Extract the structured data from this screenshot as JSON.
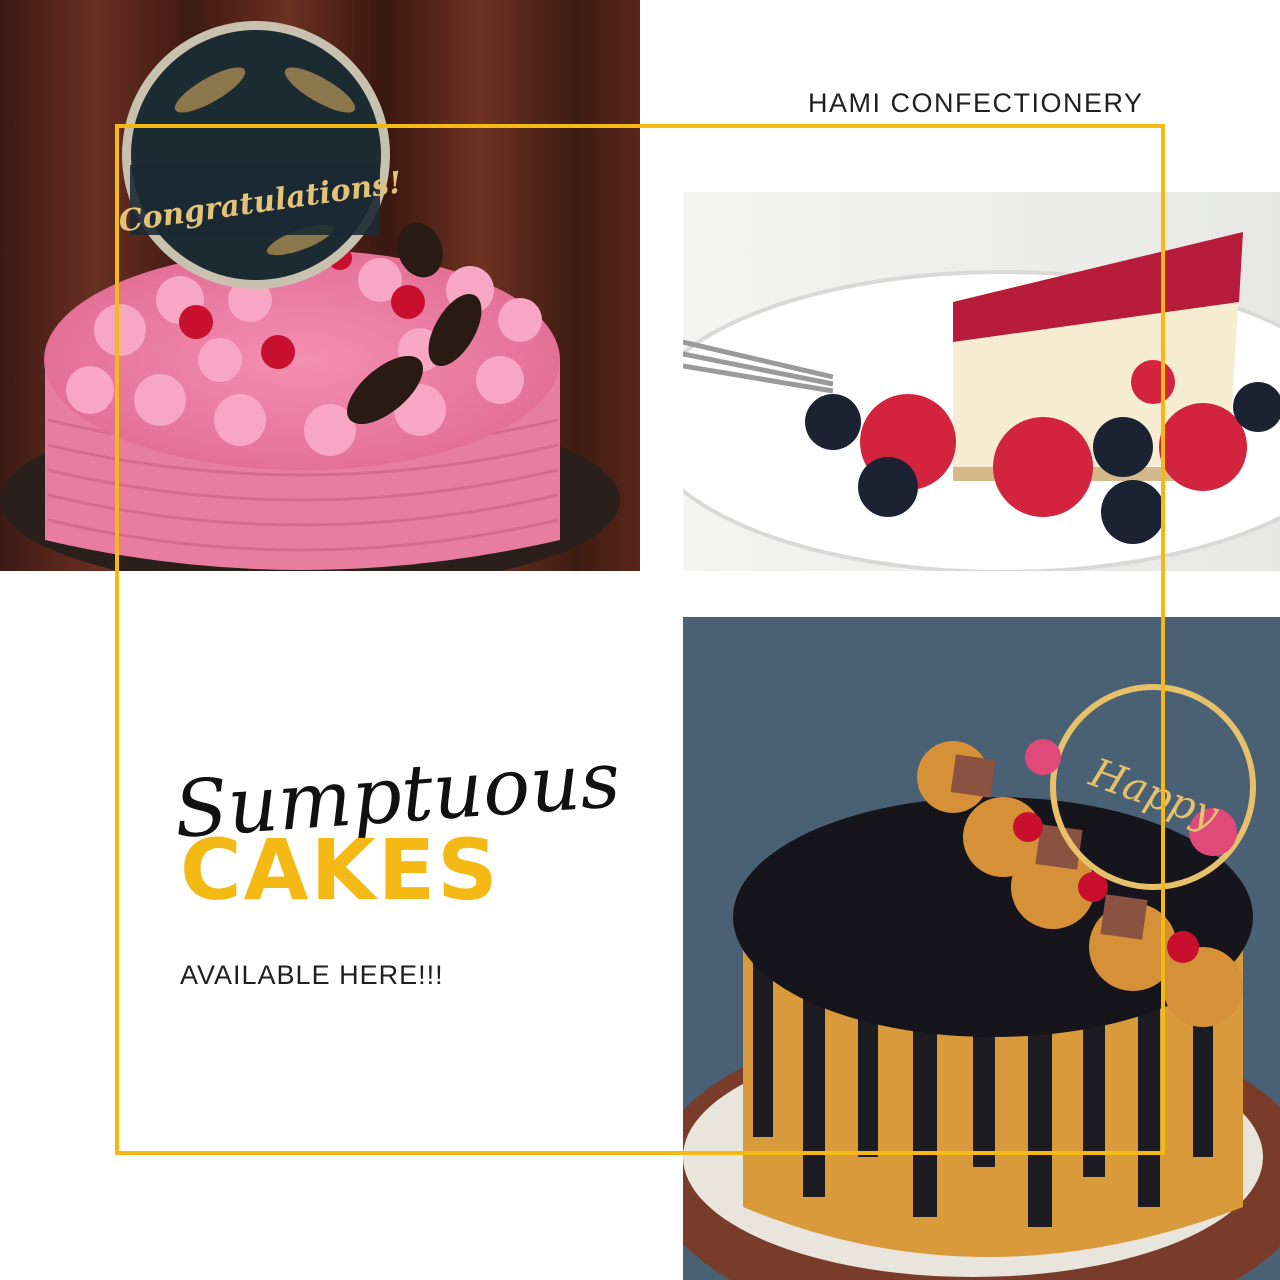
{
  "brand": {
    "name": "HAMI CONFECTIONERY",
    "accent_color": "#F5B915"
  },
  "headline": {
    "script_word": "Sumptuous",
    "main_word": "CAKES",
    "tagline": "AVAILABLE HERE!!!"
  },
  "photos": {
    "pink_cake": {
      "topper_text": "Congratulations!"
    },
    "cheesecake": {},
    "drip_cake": {
      "topper_text": "Happy"
    }
  }
}
